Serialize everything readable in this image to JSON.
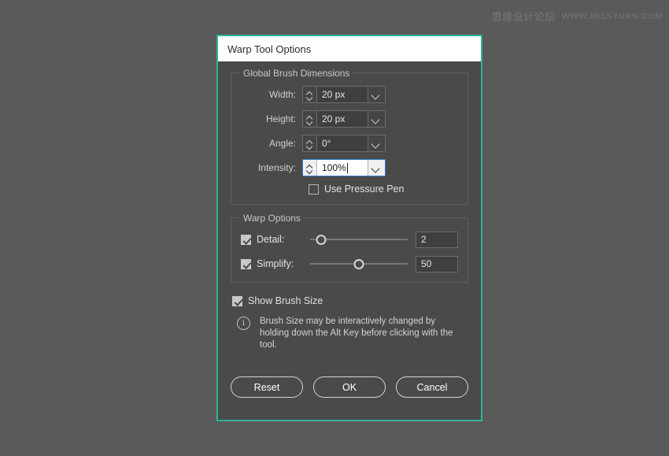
{
  "watermark": {
    "cn": "思缘设计论坛",
    "en": "WWW.MISSYUAN.COM"
  },
  "dialog": {
    "title": "Warp Tool Options",
    "accent_color": "#2eb39b",
    "body_background": "#4a4a4a",
    "page_background": "#5a5a5a"
  },
  "global_brush_dimensions": {
    "legend": "Global Brush Dimensions",
    "fields": [
      {
        "label": "Width:",
        "value": "20 px",
        "focused": false
      },
      {
        "label": "Height:",
        "value": "20 px",
        "focused": false
      },
      {
        "label": "Angle:",
        "value": "0°",
        "focused": false
      },
      {
        "label": "Intensity:",
        "value": "100%",
        "focused": true
      }
    ],
    "use_pressure_pen": {
      "label": "Use Pressure Pen",
      "checked": false
    }
  },
  "warp_options": {
    "legend": "Warp Options",
    "sliders": [
      {
        "label": "Detail:",
        "checked": true,
        "value": "2",
        "position_percent": 11
      },
      {
        "label": "Simplify:",
        "checked": true,
        "value": "50",
        "position_percent": 50
      }
    ]
  },
  "show_brush_size": {
    "label": "Show Brush Size",
    "checked": true
  },
  "info": {
    "icon": "info-icon",
    "text": "Brush Size may be interactively changed by holding down the Alt Key before clicking with the tool."
  },
  "buttons": {
    "reset": "Reset",
    "ok": "OK",
    "cancel": "Cancel"
  }
}
